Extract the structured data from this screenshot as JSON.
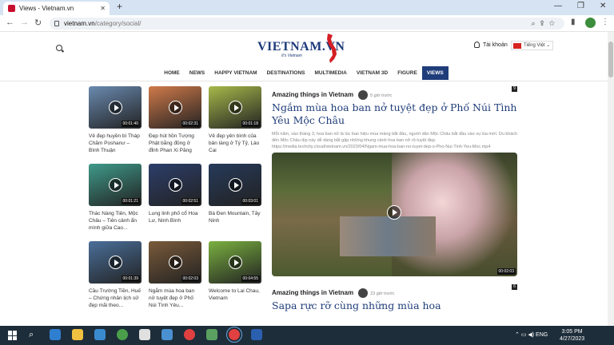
{
  "browser": {
    "tab_title": "Views - Vietnam.vn",
    "url_domain": "vietnam.vn",
    "url_path": "/category/social/"
  },
  "site": {
    "logo": "VIETNAM.VN",
    "logo_tagline": "It's Vietnam",
    "login_label": "Tài khoản",
    "language": "Tiếng Việt",
    "menu": [
      "HOME",
      "NEWS",
      "HAPPY VIETNAM",
      "DESTINATIONS",
      "MULTIMEDIA",
      "VIETNAM 3D",
      "FIGURE",
      "VIEWS"
    ],
    "active_menu": "VIEWS"
  },
  "sidebar_videos": [
    {
      "title": "Vẻ đẹp huyền bí Tháp Chăm Poshanư – Bình Thuận",
      "duration": "00:01:40",
      "color": "#6a8ab0"
    },
    {
      "title": "Đẹp hút hồn Tượng Phật bằng đồng ở đỉnh Phan Xi Păng",
      "duration": "00:02:31",
      "color": "#d07a4a"
    },
    {
      "title": "Vẻ đẹp yên bình của bản làng ở Tý Tỷ, Lào Cai",
      "duration": "00:01:18",
      "color": "#a7b94a"
    },
    {
      "title": "Thác Nàng Tiên, Mộc Châu – Tiên cảnh ẩn mình giữa Cao...",
      "duration": "00:01:21",
      "color": "#3f9a8a"
    },
    {
      "title": "Lung linh phố cổ Hoa Lư, Ninh Bình",
      "duration": "00:02:51",
      "color": "#2c3e6a"
    },
    {
      "title": "Bà Đen Mountain, Tây Ninh",
      "duration": "00:03:01",
      "color": "#263a5a"
    },
    {
      "title": "Cầu Trường Tiền, Huế – Chứng nhân lịch sử đẹp mãi theo...",
      "duration": "00:01:39",
      "color": "#4a6f9a"
    },
    {
      "title": "Ngắm mùa hoa ban nở tuyệt đẹp ở Phố Núi Tình Yêu...",
      "duration": "00:02:03",
      "color": "#7a5a3a"
    },
    {
      "title": "Welcome to Lai Chau, Vietnam",
      "duration": "00:04:55",
      "color": "#7ab040"
    }
  ],
  "articles": [
    {
      "category": "Amazing things in Vietnam",
      "time": "5 giờ trước",
      "badge": "9",
      "title": "Ngắm mùa hoa ban nở tuyệt đẹp ở Phố Núi Tình Yêu Mộc Châu",
      "description": "Mỗi năm, vào tháng 3, hoa ban nở là lúc bao hiệu mùa màng bắt đầu, người dân Mộc Châu bắt đầu vào vụ lúa mới. Du khách đến Mộc Châu dịp này dễ dàng bắt gặp những khung cảnh hoa ban nở rộ tuyệt đẹp. https://media.techcity.cloud/vietnam.vn/2023/04/Ngam-mua-hoa-ban-no-tuyet-dep-o-Pho-Nui-Tinh-Yeu-Moc.mp4",
      "duration": "00:02:03"
    },
    {
      "category": "Amazing things in Vietnam",
      "time": "23 giờ trước",
      "badge": "6",
      "title": "Sapa rực rỡ cùng những mùa hoa"
    }
  ],
  "taskbar": {
    "language": "ENG",
    "time": "3:05 PM",
    "date": "4/27/2023"
  }
}
